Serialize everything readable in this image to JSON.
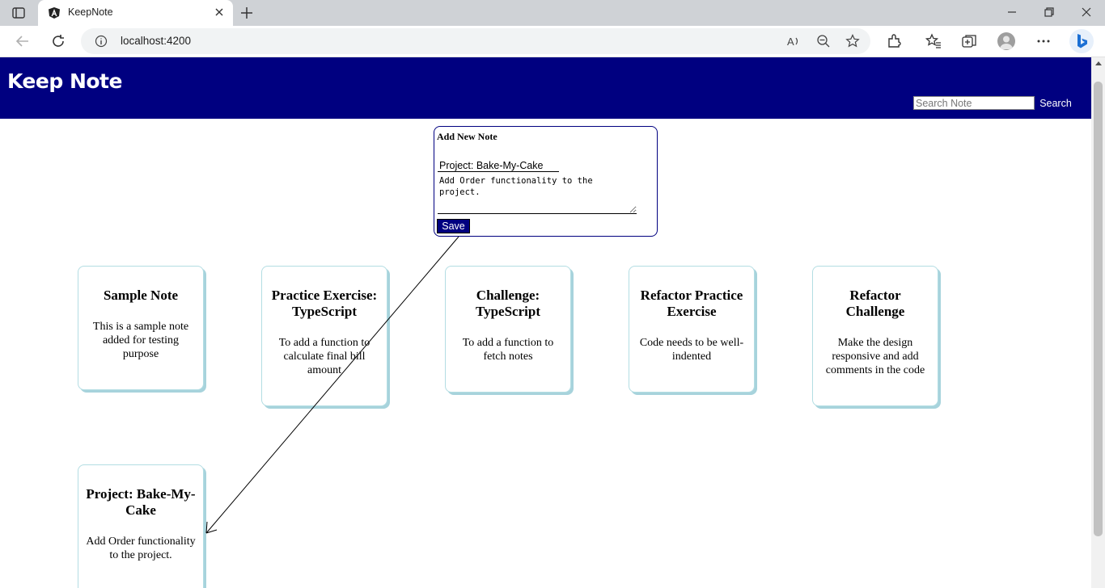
{
  "browser": {
    "tab_title": "KeepNote",
    "url": "localhost:4200"
  },
  "app": {
    "brand": "Keep Note",
    "search": {
      "placeholder": "Search Note",
      "button_label": "Search"
    },
    "colors": {
      "primary": "#000080",
      "card_border": "#b3dde3"
    }
  },
  "add_note": {
    "heading": "Add New Note",
    "title_value": "Project: Bake-My-Cake",
    "body_value": "Add Order functionality to the project.",
    "save_label": "Save"
  },
  "notes": [
    {
      "title": "Sample Note",
      "text": "This is a sample note added for testing purpose"
    },
    {
      "title": "Practice Exercise: TypeScript",
      "text": "To add a function to calculate final bill amount"
    },
    {
      "title": "Challenge: TypeScript",
      "text": "To add a function to fetch notes"
    },
    {
      "title": "Refactor Practice Exercise",
      "text": "Code needs to be well-indented"
    },
    {
      "title": "Refactor Challenge",
      "text": "Make the design responsive and add comments in the code"
    },
    {
      "title": "Project: Bake-My-Cake",
      "text": "Add Order functionality to the project."
    }
  ]
}
